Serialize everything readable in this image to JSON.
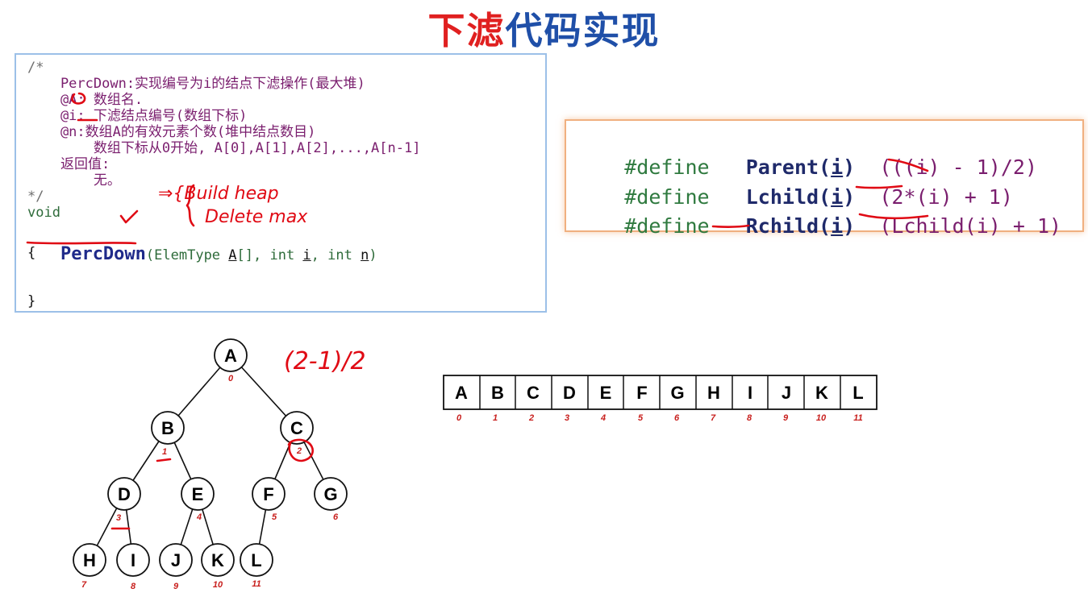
{
  "title": {
    "part1": "下滤",
    "part2": "代码实现"
  },
  "code": {
    "lines": [
      "/*",
      "    PercDown:实现编号为i的结点下滤操作(最大堆)",
      "    @A: 数组名.",
      "    @i: 下滤结点编号(数组下标)",
      "    @n:数组A的有效元素个数(堆中结点数目)",
      "        数组下标从0开始, A[0],A[1],A[2],...,A[n-1]",
      "    返回值:",
      "        无。",
      "*/",
      "void"
    ],
    "func_name": "PercDown",
    "params_prefix": "(ElemType ",
    "param_a": "A",
    "params_mid1": "[], int ",
    "param_i": "i",
    "params_mid2": ", int ",
    "param_n": "n",
    "params_suffix": ")",
    "open_brace": "{",
    "close_brace": "}"
  },
  "defines": [
    {
      "kw": "#define",
      "name": "Parent",
      "arg": "i",
      "body": "(((i) - 1)/2)"
    },
    {
      "kw": "#define",
      "name": "Lchild",
      "arg": "i",
      "body": "(2*(i) + 1)"
    },
    {
      "kw": "#define",
      "name": "Rchild",
      "arg": "i",
      "body": "(Lchild(i) + 1)"
    }
  ],
  "handwriting": {
    "note1": "⇒{Build heap",
    "note2": "Delete max",
    "formula": "(2-1)/2"
  },
  "tree": {
    "nodes": [
      {
        "label": "A",
        "index": "0"
      },
      {
        "label": "B",
        "index": "1"
      },
      {
        "label": "C",
        "index": "2"
      },
      {
        "label": "D",
        "index": "3"
      },
      {
        "label": "E",
        "index": "4"
      },
      {
        "label": "F",
        "index": "5"
      },
      {
        "label": "G",
        "index": "6"
      },
      {
        "label": "H",
        "index": "7"
      },
      {
        "label": "I",
        "index": "8"
      },
      {
        "label": "J",
        "index": "9"
      },
      {
        "label": "K",
        "index": "10"
      },
      {
        "label": "L",
        "index": "11"
      }
    ]
  },
  "array": {
    "cells": [
      "A",
      "B",
      "C",
      "D",
      "E",
      "F",
      "G",
      "H",
      "I",
      "J",
      "K",
      "L"
    ],
    "indices": [
      "0",
      "1",
      "2",
      "3",
      "4",
      "5",
      "6",
      "7",
      "8",
      "9",
      "10",
      "11"
    ]
  },
  "colors": {
    "title_red": "#e02020",
    "title_blue": "#1f4fa8",
    "handwriting": "#e00a14",
    "index_red": "#c8201e"
  }
}
